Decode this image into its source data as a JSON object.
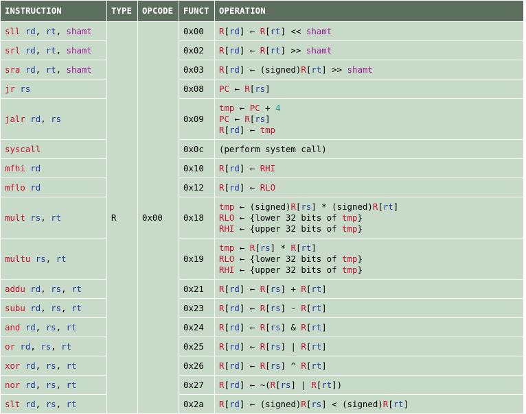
{
  "header": {
    "instruction": "INSTRUCTION",
    "type": "TYPE",
    "opcode": "OPCODE",
    "funct": "FUNCT",
    "operation": "OPERATION"
  },
  "group": {
    "type": "R",
    "opcode": "0x00"
  },
  "rows": [
    {
      "funct": "0x00",
      "instr": [
        [
          "sll",
          "k"
        ],
        [
          " rd",
          "g"
        ],
        [
          ", ",
          "b"
        ],
        [
          "rt",
          "g"
        ],
        [
          ", ",
          "b"
        ],
        [
          "shamt",
          "p"
        ]
      ],
      "op": [
        [
          [
            "R",
            "k"
          ],
          [
            "[",
            "b"
          ],
          [
            "rd",
            "g"
          ],
          [
            "] ← ",
            "b"
          ],
          [
            "R",
            "k"
          ],
          [
            "[",
            "b"
          ],
          [
            "rt",
            "g"
          ],
          [
            "] << ",
            "b"
          ],
          [
            "shamt",
            "p"
          ]
        ]
      ]
    },
    {
      "funct": "0x02",
      "instr": [
        [
          "srl",
          "k"
        ],
        [
          " rd",
          "g"
        ],
        [
          ", ",
          "b"
        ],
        [
          "rt",
          "g"
        ],
        [
          ", ",
          "b"
        ],
        [
          "shamt",
          "p"
        ]
      ],
      "op": [
        [
          [
            "R",
            "k"
          ],
          [
            "[",
            "b"
          ],
          [
            "rd",
            "g"
          ],
          [
            "] ← ",
            "b"
          ],
          [
            "R",
            "k"
          ],
          [
            "[",
            "b"
          ],
          [
            "rt",
            "g"
          ],
          [
            "] >> ",
            "b"
          ],
          [
            "shamt",
            "p"
          ]
        ]
      ]
    },
    {
      "funct": "0x03",
      "instr": [
        [
          "sra",
          "k"
        ],
        [
          " rd",
          "g"
        ],
        [
          ", ",
          "b"
        ],
        [
          "rt",
          "g"
        ],
        [
          ", ",
          "b"
        ],
        [
          "shamt",
          "p"
        ]
      ],
      "op": [
        [
          [
            "R",
            "k"
          ],
          [
            "[",
            "b"
          ],
          [
            "rd",
            "g"
          ],
          [
            "] ← (signed)",
            "b"
          ],
          [
            "R",
            "k"
          ],
          [
            "[",
            "b"
          ],
          [
            "rt",
            "g"
          ],
          [
            "] >> ",
            "b"
          ],
          [
            "shamt",
            "p"
          ]
        ]
      ]
    },
    {
      "funct": "0x08",
      "instr": [
        [
          "jr",
          "k"
        ],
        [
          " rs",
          "g"
        ]
      ],
      "op": [
        [
          [
            "PC",
            "k"
          ],
          [
            " ← ",
            "b"
          ],
          [
            "R",
            "k"
          ],
          [
            "[",
            "b"
          ],
          [
            "rs",
            "g"
          ],
          [
            "]",
            "b"
          ]
        ]
      ]
    },
    {
      "funct": "0x09",
      "instr": [
        [
          "jalr",
          "k"
        ],
        [
          " rd",
          "g"
        ],
        [
          ", ",
          "b"
        ],
        [
          "rs",
          "g"
        ]
      ],
      "op": [
        [
          [
            "tmp",
            "k"
          ],
          [
            " ← ",
            "b"
          ],
          [
            "PC",
            "k"
          ],
          [
            " + ",
            "b"
          ],
          [
            "4",
            "t"
          ]
        ],
        [
          [
            "PC",
            "k"
          ],
          [
            " ← ",
            "b"
          ],
          [
            "R",
            "k"
          ],
          [
            "[",
            "b"
          ],
          [
            "rs",
            "g"
          ],
          [
            "]",
            "b"
          ]
        ],
        [
          [
            "R",
            "k"
          ],
          [
            "[",
            "b"
          ],
          [
            "rd",
            "g"
          ],
          [
            "] ← ",
            "b"
          ],
          [
            "tmp",
            "k"
          ]
        ]
      ]
    },
    {
      "funct": "0x0c",
      "instr": [
        [
          "syscall",
          "k"
        ]
      ],
      "op": [
        [
          [
            "(perform system call)",
            "b"
          ]
        ]
      ]
    },
    {
      "funct": "0x10",
      "instr": [
        [
          "mfhi",
          "k"
        ],
        [
          " rd",
          "g"
        ]
      ],
      "op": [
        [
          [
            "R",
            "k"
          ],
          [
            "[",
            "b"
          ],
          [
            "rd",
            "g"
          ],
          [
            "] ← ",
            "b"
          ],
          [
            "RHI",
            "k"
          ]
        ]
      ]
    },
    {
      "funct": "0x12",
      "instr": [
        [
          "mflo",
          "k"
        ],
        [
          " rd",
          "g"
        ]
      ],
      "op": [
        [
          [
            "R",
            "k"
          ],
          [
            "[",
            "b"
          ],
          [
            "rd",
            "g"
          ],
          [
            "] ← ",
            "b"
          ],
          [
            "RLO",
            "k"
          ]
        ]
      ]
    },
    {
      "funct": "0x18",
      "instr": [
        [
          "mult",
          "k"
        ],
        [
          " rs",
          "g"
        ],
        [
          ", ",
          "b"
        ],
        [
          "rt",
          "g"
        ]
      ],
      "op": [
        [
          [
            "tmp",
            "k"
          ],
          [
            " ← (signed)",
            "b"
          ],
          [
            "R",
            "k"
          ],
          [
            "[",
            "b"
          ],
          [
            "rs",
            "g"
          ],
          [
            "] * (signed)",
            "b"
          ],
          [
            "R",
            "k"
          ],
          [
            "[",
            "b"
          ],
          [
            "rt",
            "g"
          ],
          [
            "]",
            "b"
          ]
        ],
        [
          [
            "RLO",
            "k"
          ],
          [
            " ← {lower 32 bits of ",
            "b"
          ],
          [
            "tmp",
            "k"
          ],
          [
            "}",
            "b"
          ]
        ],
        [
          [
            "RHI",
            "k"
          ],
          [
            " ← {upper 32 bits of ",
            "b"
          ],
          [
            "tmp",
            "k"
          ],
          [
            "}",
            "b"
          ]
        ]
      ]
    },
    {
      "funct": "0x19",
      "instr": [
        [
          "multu",
          "k"
        ],
        [
          " rs",
          "g"
        ],
        [
          ", ",
          "b"
        ],
        [
          "rt",
          "g"
        ]
      ],
      "op": [
        [
          [
            "tmp",
            "k"
          ],
          [
            " ← ",
            "b"
          ],
          [
            "R",
            "k"
          ],
          [
            "[",
            "b"
          ],
          [
            "rs",
            "g"
          ],
          [
            "] * ",
            "b"
          ],
          [
            "R",
            "k"
          ],
          [
            "[",
            "b"
          ],
          [
            "rt",
            "g"
          ],
          [
            "]",
            "b"
          ]
        ],
        [
          [
            "RLO",
            "k"
          ],
          [
            " ← {lower 32 bits of ",
            "b"
          ],
          [
            "tmp",
            "k"
          ],
          [
            "}",
            "b"
          ]
        ],
        [
          [
            "RHI",
            "k"
          ],
          [
            " ← {upper 32 bits of ",
            "b"
          ],
          [
            "tmp",
            "k"
          ],
          [
            "}",
            "b"
          ]
        ]
      ]
    },
    {
      "funct": "0x21",
      "instr": [
        [
          "addu",
          "k"
        ],
        [
          " rd",
          "g"
        ],
        [
          ", ",
          "b"
        ],
        [
          "rs",
          "g"
        ],
        [
          ", ",
          "b"
        ],
        [
          "rt",
          "g"
        ]
      ],
      "op": [
        [
          [
            "R",
            "k"
          ],
          [
            "[",
            "b"
          ],
          [
            "rd",
            "g"
          ],
          [
            "] ← ",
            "b"
          ],
          [
            "R",
            "k"
          ],
          [
            "[",
            "b"
          ],
          [
            "rs",
            "g"
          ],
          [
            "] + ",
            "b"
          ],
          [
            "R",
            "k"
          ],
          [
            "[",
            "b"
          ],
          [
            "rt",
            "g"
          ],
          [
            "]",
            "b"
          ]
        ]
      ]
    },
    {
      "funct": "0x23",
      "instr": [
        [
          "subu",
          "k"
        ],
        [
          " rd",
          "g"
        ],
        [
          ", ",
          "b"
        ],
        [
          "rs",
          "g"
        ],
        [
          ", ",
          "b"
        ],
        [
          "rt",
          "g"
        ]
      ],
      "op": [
        [
          [
            "R",
            "k"
          ],
          [
            "[",
            "b"
          ],
          [
            "rd",
            "g"
          ],
          [
            "] ← ",
            "b"
          ],
          [
            "R",
            "k"
          ],
          [
            "[",
            "b"
          ],
          [
            "rs",
            "g"
          ],
          [
            "] - ",
            "b"
          ],
          [
            "R",
            "k"
          ],
          [
            "[",
            "b"
          ],
          [
            "rt",
            "g"
          ],
          [
            "]",
            "b"
          ]
        ]
      ]
    },
    {
      "funct": "0x24",
      "instr": [
        [
          "and",
          "k"
        ],
        [
          " rd",
          "g"
        ],
        [
          ", ",
          "b"
        ],
        [
          "rs",
          "g"
        ],
        [
          ", ",
          "b"
        ],
        [
          "rt",
          "g"
        ]
      ],
      "op": [
        [
          [
            "R",
            "k"
          ],
          [
            "[",
            "b"
          ],
          [
            "rd",
            "g"
          ],
          [
            "] ← ",
            "b"
          ],
          [
            "R",
            "k"
          ],
          [
            "[",
            "b"
          ],
          [
            "rs",
            "g"
          ],
          [
            "] & ",
            "b"
          ],
          [
            "R",
            "k"
          ],
          [
            "[",
            "b"
          ],
          [
            "rt",
            "g"
          ],
          [
            "]",
            "b"
          ]
        ]
      ]
    },
    {
      "funct": "0x25",
      "instr": [
        [
          "or",
          "k"
        ],
        [
          " rd",
          "g"
        ],
        [
          ", ",
          "b"
        ],
        [
          "rs",
          "g"
        ],
        [
          ", ",
          "b"
        ],
        [
          "rt",
          "g"
        ]
      ],
      "op": [
        [
          [
            "R",
            "k"
          ],
          [
            "[",
            "b"
          ],
          [
            "rd",
            "g"
          ],
          [
            "] ← ",
            "b"
          ],
          [
            "R",
            "k"
          ],
          [
            "[",
            "b"
          ],
          [
            "rs",
            "g"
          ],
          [
            "] | ",
            "b"
          ],
          [
            "R",
            "k"
          ],
          [
            "[",
            "b"
          ],
          [
            "rt",
            "g"
          ],
          [
            "]",
            "b"
          ]
        ]
      ]
    },
    {
      "funct": "0x26",
      "instr": [
        [
          "xor",
          "k"
        ],
        [
          " rd",
          "g"
        ],
        [
          ", ",
          "b"
        ],
        [
          "rs",
          "g"
        ],
        [
          ", ",
          "b"
        ],
        [
          "rt",
          "g"
        ]
      ],
      "op": [
        [
          [
            "R",
            "k"
          ],
          [
            "[",
            "b"
          ],
          [
            "rd",
            "g"
          ],
          [
            "] ← ",
            "b"
          ],
          [
            "R",
            "k"
          ],
          [
            "[",
            "b"
          ],
          [
            "rs",
            "g"
          ],
          [
            "] ^ ",
            "b"
          ],
          [
            "R",
            "k"
          ],
          [
            "[",
            "b"
          ],
          [
            "rt",
            "g"
          ],
          [
            "]",
            "b"
          ]
        ]
      ]
    },
    {
      "funct": "0x27",
      "instr": [
        [
          "nor",
          "k"
        ],
        [
          " rd",
          "g"
        ],
        [
          ", ",
          "b"
        ],
        [
          "rs",
          "g"
        ],
        [
          ", ",
          "b"
        ],
        [
          "rt",
          "g"
        ]
      ],
      "op": [
        [
          [
            "R",
            "k"
          ],
          [
            "[",
            "b"
          ],
          [
            "rd",
            "g"
          ],
          [
            "] ← ~(",
            "b"
          ],
          [
            "R",
            "k"
          ],
          [
            "[",
            "b"
          ],
          [
            "rs",
            "g"
          ],
          [
            "] | ",
            "b"
          ],
          [
            "R",
            "k"
          ],
          [
            "[",
            "b"
          ],
          [
            "rt",
            "g"
          ],
          [
            "])",
            "b"
          ]
        ]
      ]
    },
    {
      "funct": "0x2a",
      "instr": [
        [
          "slt",
          "k"
        ],
        [
          " rd",
          "g"
        ],
        [
          ", ",
          "b"
        ],
        [
          "rs",
          "g"
        ],
        [
          ", ",
          "b"
        ],
        [
          "rt",
          "g"
        ]
      ],
      "op": [
        [
          [
            "R",
            "k"
          ],
          [
            "[",
            "b"
          ],
          [
            "rd",
            "g"
          ],
          [
            "] ← (signed)",
            "b"
          ],
          [
            "R",
            "k"
          ],
          [
            "[",
            "b"
          ],
          [
            "rs",
            "g"
          ],
          [
            "] < (signed)",
            "b"
          ],
          [
            "R",
            "k"
          ],
          [
            "[",
            "b"
          ],
          [
            "rt",
            "g"
          ],
          [
            "]",
            "b"
          ]
        ]
      ]
    }
  ]
}
